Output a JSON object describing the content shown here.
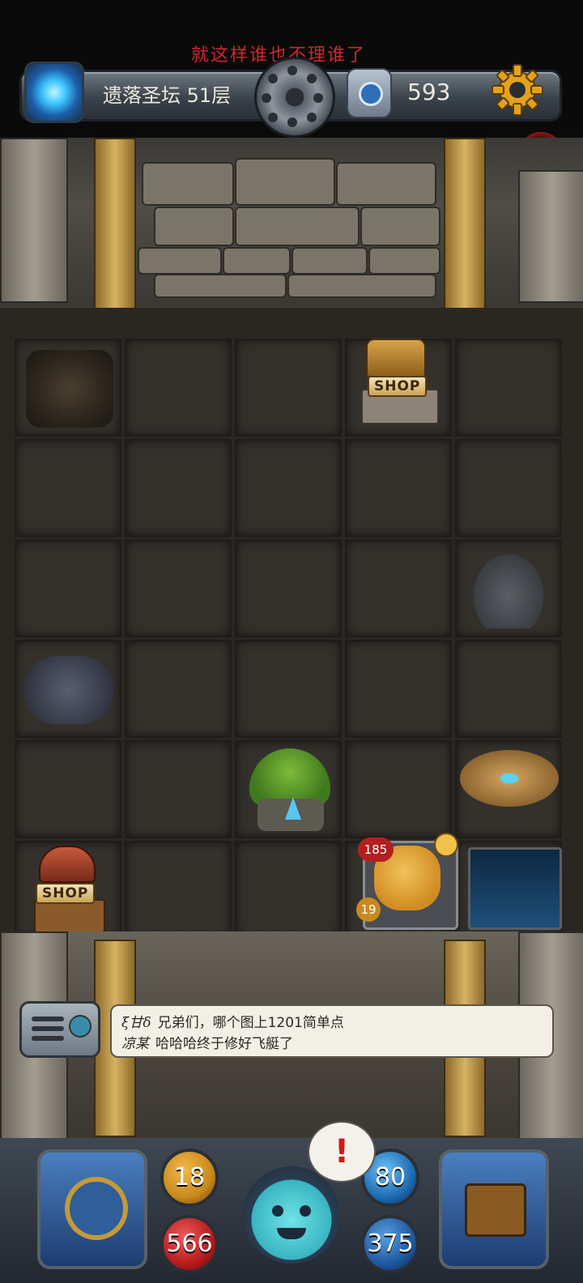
{
  "watermark": "就这样谁也不理谁了",
  "top_bar": {
    "floor_name": "遗落圣坛 51层",
    "gem_count": "593",
    "icons": {
      "portal": "portal-icon",
      "center": "dungeon-wheel-icon",
      "gem": "gem-icon",
      "settings": "gear-icon",
      "npc": "npc-avatar-icon"
    }
  },
  "board": {
    "shop_top_label": "SHOP",
    "shop_bottom_label": "SHOP",
    "hero": {
      "attack_hp": "185",
      "level": "19"
    }
  },
  "chat": {
    "lines": [
      {
        "sender": "ξ甘δ",
        "text": "兄弟们，哪个图上1201简单点"
      },
      {
        "sender": "凉某",
        "text": "哈哈哈终于修好飞艇了"
      }
    ]
  },
  "hud": {
    "attack": "18",
    "hp": "566",
    "defense": "80",
    "mana": "375",
    "alert_symbol": "!"
  },
  "colors": {
    "watermark": "#d0262a",
    "hp_orb": "#b71d1d",
    "attack_orb": "#c8891d",
    "defense_orb": "#1e6cb4",
    "mana_orb": "#1e5aa0"
  }
}
